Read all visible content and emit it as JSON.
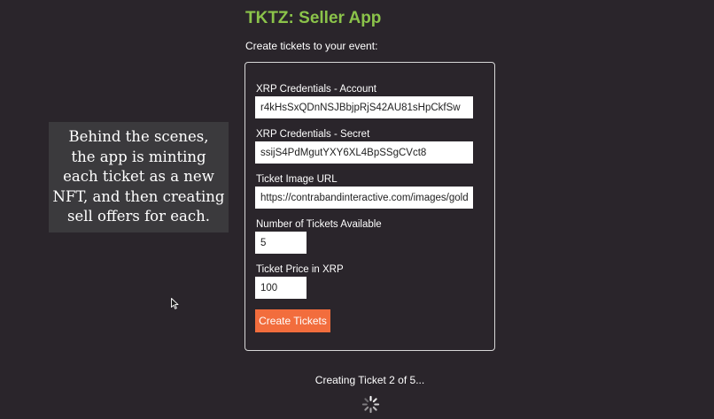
{
  "app": {
    "title": "TKTZ: Seller App",
    "subtitle": "Create tickets to your event:"
  },
  "form": {
    "account_label": "XRP Credentials - Account",
    "account_value": "r4kHsSxQDnNSJBbjpRjS42AU81sHpCkfSw",
    "secret_label": "XRP Credentials - Secret",
    "secret_value": "ssijS4PdMgutYXY6XL4BpSSgCVct8",
    "image_label": "Ticket Image URL",
    "image_value": "https://contrabandinteractive.com/images/golden-ticket.png",
    "count_label": "Number of Tickets Available",
    "count_value": "5",
    "price_label": "Ticket Price in XRP",
    "price_value": "100",
    "submit_label": "Create Tickets"
  },
  "status": {
    "message": "Creating Ticket 2 of 5..."
  },
  "overlay": {
    "lines": [
      "Behind the scenes,",
      "the app is minting",
      "each ticket as a new",
      "NFT, and then creating",
      "sell offers for each."
    ]
  },
  "icons": {
    "spinner": "loading-spinner-icon",
    "cursor": "mouse-pointer-icon"
  },
  "colors": {
    "background": "#2a252b",
    "title": "#8bc34a",
    "button": "#f26d3d",
    "overlay_bg": "#3b3a3d"
  }
}
